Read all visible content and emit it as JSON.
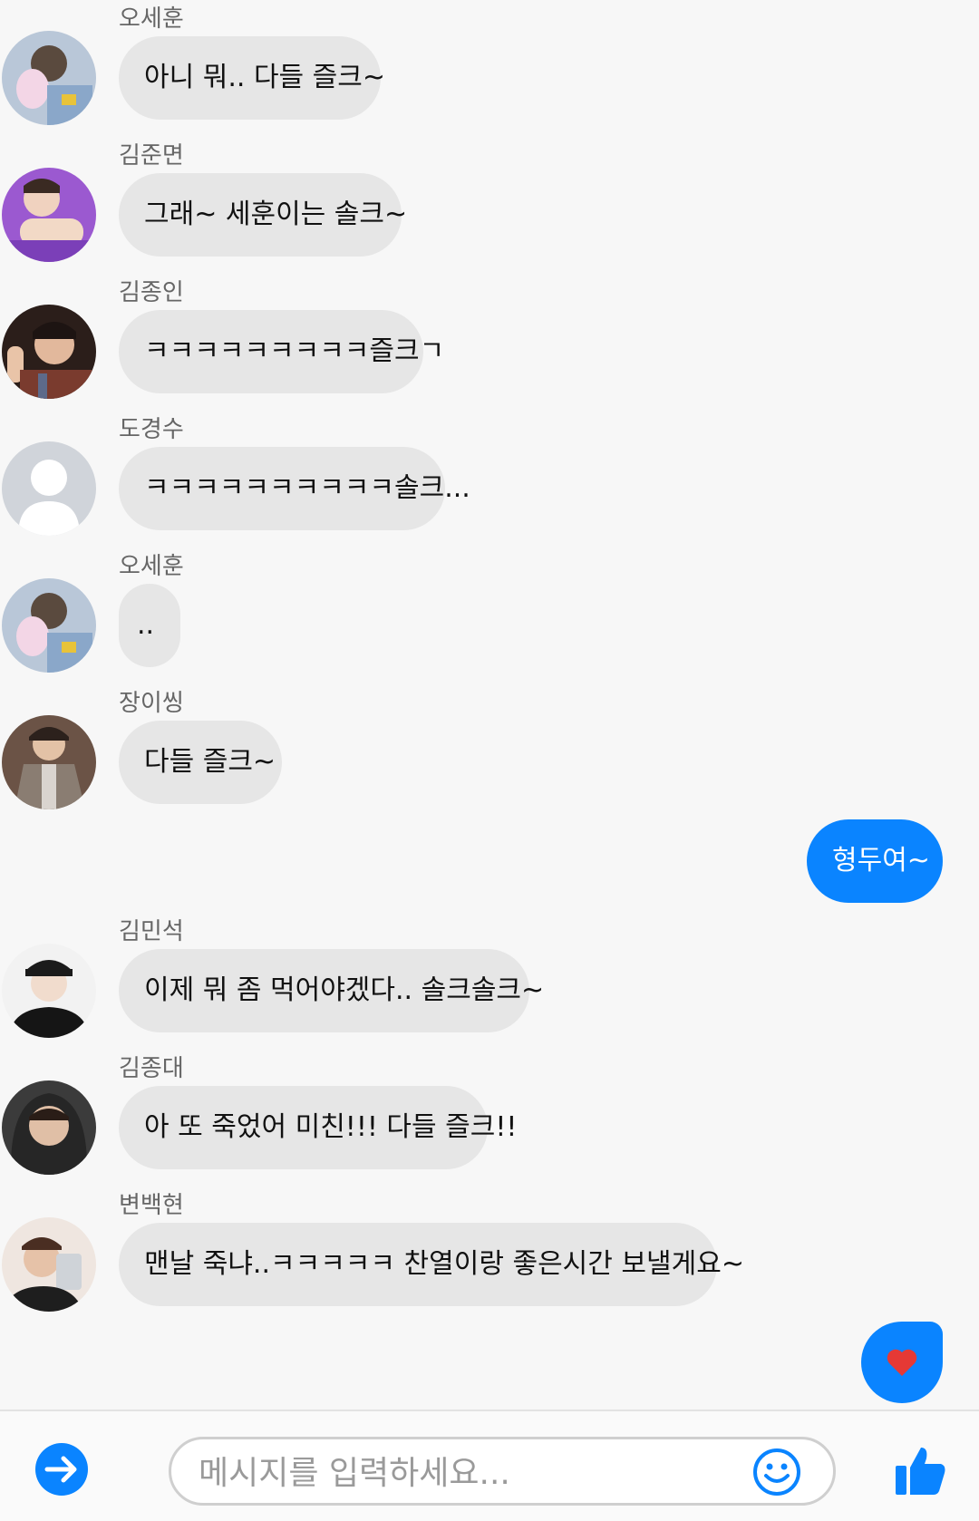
{
  "messages": [
    {
      "sender": "오세훈",
      "text": "아니 뭐.. 다들 즐크~"
    },
    {
      "sender": "김준면",
      "text": "그래~ 세훈이는 솔크~"
    },
    {
      "sender": "김종인",
      "text": "ㅋㅋㅋㅋㅋㅋㅋㅋㅋ즐크ㄱ"
    },
    {
      "sender": "도경수",
      "text": "ㅋㅋㅋㅋㅋㅋㅋㅋㅋㅋ솔크..."
    },
    {
      "sender": "오세훈",
      "text": ".."
    },
    {
      "sender": "장이씽",
      "text": "다들 즐크~"
    },
    {
      "sender": "김민석",
      "text": "이제 뭐 좀 먹어야겠다.. 솔크솔크~"
    },
    {
      "sender": "김종대",
      "text": "아 또 죽었어 미친!!! 다들 즐크!!"
    },
    {
      "sender": "변백현",
      "text": "맨날 죽냐..ㅋㅋㅋㅋㅋ 찬열이랑 좋은시간 보낼게요~"
    }
  ],
  "my_messages": [
    {
      "text": "형두여~"
    }
  ],
  "composer": {
    "placeholder": "메시지를 입력하세요..."
  },
  "colors": {
    "accent": "#0a84ff",
    "bubble_gray": "#e6e6e6",
    "background": "#f7f7f7",
    "heart": "#e53935"
  },
  "icons": {
    "send": "arrow-right-circle-icon",
    "emoji": "smiley-icon",
    "like": "thumbs-up-icon",
    "reaction": "heart-icon"
  }
}
